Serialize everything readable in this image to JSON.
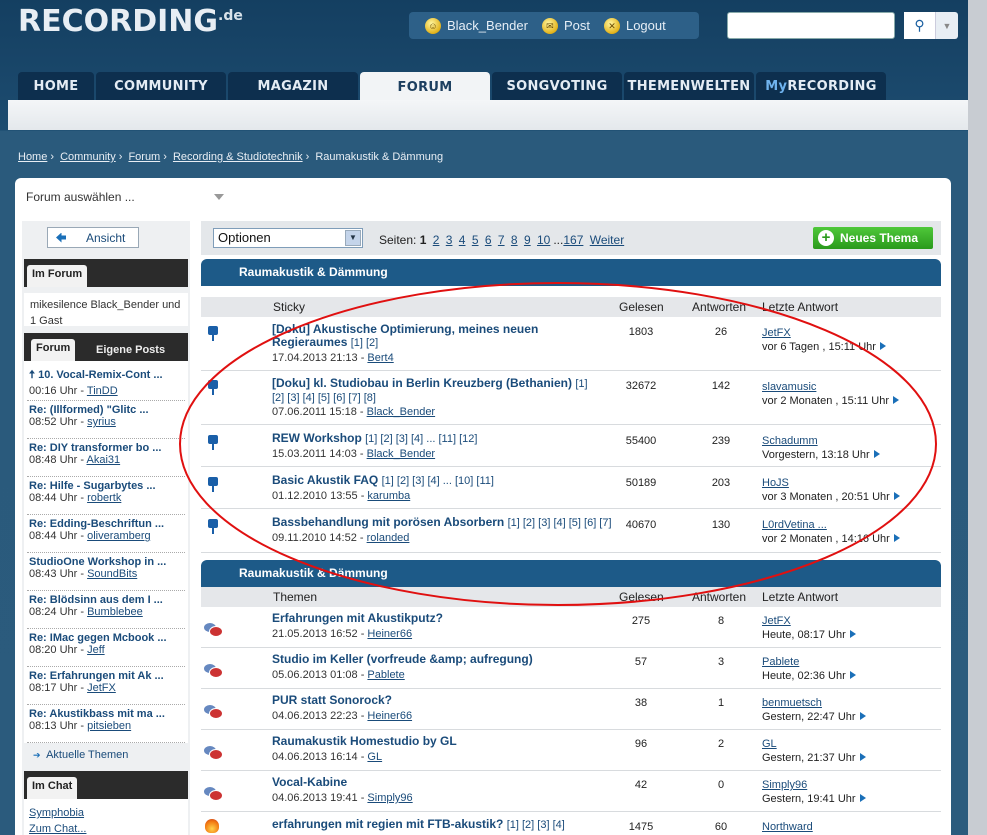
{
  "header": {
    "logo": "RECORDING",
    "logo_suffix": ".de",
    "user": "Black_Bender",
    "post": "Post",
    "logout": "Logout",
    "search_placeholder": ""
  },
  "nav": {
    "tabs": [
      "HOME",
      "COMMUNITY",
      "MAGAZIN",
      "FORUM",
      "SONGVOTING",
      "THEMENWELTEN"
    ],
    "my_prefix": "My",
    "my_suffix": "RECORDING",
    "active": "FORUM"
  },
  "breadcrumb": [
    "Home",
    "Community",
    "Forum",
    "Recording & Studiotechnik",
    "Raumakustik & Dämmung"
  ],
  "forum_select": "Forum auswählen ...",
  "sidebar": {
    "ansicht": "Ansicht",
    "im_forum_tab": "Im Forum",
    "online_text": "mikesilence Black_Bender und 1 Gast",
    "forum_tab": "Forum",
    "eigene_posts_tab": "Eigene Posts",
    "recent": [
      {
        "title": "10. Vocal-Remix-Cont ...",
        "time": "00:16 Uhr - ",
        "user": "TinDD",
        "pinned": true
      },
      {
        "title": "Re: (Illformed) \"Glitc ...",
        "time": "08:52 Uhr - ",
        "user": "syrius"
      },
      {
        "title": "Re: DIY transformer bo ...",
        "time": "08:48 Uhr - ",
        "user": "Akai31"
      },
      {
        "title": "Re: Hilfe - Sugarbytes ...",
        "time": "08:44 Uhr - ",
        "user": "robertk"
      },
      {
        "title": "Re: Edding-Beschriftun ...",
        "time": "08:44 Uhr - ",
        "user": "oliveramberg"
      },
      {
        "title": "StudioOne Workshop in ...",
        "time": "08:43 Uhr - ",
        "user": "SoundBits"
      },
      {
        "title": "Re: Blödsinn aus dem I ...",
        "time": "08:24 Uhr - ",
        "user": "Bumblebee"
      },
      {
        "title": "Re: IMac gegen Mcbook ...",
        "time": "08:20 Uhr - ",
        "user": "Jeff"
      },
      {
        "title": "Re: Erfahrungen mit Ak ...",
        "time": "08:17 Uhr - ",
        "user": "JetFX"
      },
      {
        "title": "Re: Akustikbass mit ma ...",
        "time": "08:13 Uhr - ",
        "user": "pitsieben"
      }
    ],
    "aktuelle_themen": "Aktuelle Themen",
    "im_chat_tab": "Im Chat",
    "chat_users": [
      "Symphobia",
      "Zum Chat..."
    ]
  },
  "toolbar": {
    "optionen": "Optionen",
    "seiten_label": "Seiten:",
    "current_page": "1",
    "pages": [
      "2",
      "3",
      "4",
      "5",
      "6",
      "7",
      "8",
      "9",
      "10"
    ],
    "ellipsis": "...",
    "last_page": "167",
    "weiter": "Weiter",
    "new_thread": "Neues Thema"
  },
  "sticky_section": {
    "title": "Raumakustik & Dämmung",
    "col_topic": "Sticky",
    "col_read": "Gelesen",
    "col_answers": "Antworten",
    "col_last": "Letzte Antwort",
    "rows": [
      {
        "title": "[Doku] Akustische Optimierung, meines neuen Regieraumes",
        "pages": "[1] [2]",
        "date": "17.04.2013 21:13 - ",
        "author": "Bert4",
        "read": "1803",
        "answers": "26",
        "last_user": "JetFX",
        "last_time": "vor 6 Tagen , 15:11 Uhr"
      },
      {
        "title": "[Doku] kl. Studiobau in Berlin Kreuzberg (Bethanien)",
        "pages": "[1] [2] [3] [4] [5] [6] [7] [8]",
        "date": "07.06.2011 15:18 - ",
        "author": "Black_Bender",
        "read": "32672",
        "answers": "142",
        "last_user": "slavamusic",
        "last_time": "vor 2 Monaten , 15:11 Uhr"
      },
      {
        "title": "REW Workshop",
        "pages": "[1] [2] [3] [4] ... [11] [12]",
        "date": "15.03.2011 14:03 - ",
        "author": "Black_Bender",
        "read": "55400",
        "answers": "239",
        "last_user": "Schadumm",
        "last_time": "Vorgestern, 13:18 Uhr"
      },
      {
        "title": "Basic Akustik FAQ",
        "pages": "[1] [2] [3] [4] ... [10] [11]",
        "date": "01.12.2010 13:55 - ",
        "author": "karumba",
        "read": "50189",
        "answers": "203",
        "last_user": "HoJS",
        "last_time": "vor 3 Monaten , 20:51 Uhr"
      },
      {
        "title": "Bassbehandlung mit porösen Absorbern",
        "pages": "[1] [2] [3] [4] [5] [6] [7]",
        "date": "09.11.2010 14:52 - ",
        "author": "rolanded",
        "read": "40670",
        "answers": "130",
        "last_user": "L0rdVetina ...",
        "last_time": "vor 2 Monaten , 14:16 Uhr"
      }
    ]
  },
  "topics_section": {
    "title": "Raumakustik & Dämmung",
    "col_topic": "Themen",
    "col_read": "Gelesen",
    "col_answers": "Antworten",
    "col_last": "Letzte Antwort",
    "rows": [
      {
        "title": "Erfahrungen mit Akustikputz?",
        "pages": "",
        "date": "21.05.2013 16:52 - ",
        "author": "Heiner66",
        "read": "275",
        "answers": "8",
        "last_user": "JetFX",
        "last_time": "Heute, 08:17 Uhr"
      },
      {
        "title": "Studio im Keller (vorfreude &amp; aufregung)",
        "pages": "",
        "date": "05.06.2013 01:08 - ",
        "author": "Pablete",
        "read": "57",
        "answers": "3",
        "last_user": "Pablete",
        "last_time": "Heute, 02:36 Uhr"
      },
      {
        "title": "PUR statt Sonorock?",
        "pages": "",
        "date": "04.06.2013 22:23 - ",
        "author": "Heiner66",
        "read": "38",
        "answers": "1",
        "last_user": "benmuetsch",
        "last_time": "Gestern, 22:47 Uhr"
      },
      {
        "title": "Raumakustik Homestudio by GL",
        "pages": "",
        "date": "04.06.2013 16:14 - ",
        "author": "GL",
        "read": "96",
        "answers": "2",
        "last_user": "GL",
        "last_time": "Gestern, 21:37 Uhr"
      },
      {
        "title": "Vocal-Kabine",
        "pages": "",
        "date": "04.06.2013 19:41 - ",
        "author": "Simply96",
        "read": "42",
        "answers": "0",
        "last_user": "Simply96",
        "last_time": "Gestern, 19:41 Uhr"
      },
      {
        "title": "erfahrungen mit regien mit FTB-akustik?",
        "pages": "[1] [2] [3] [4]",
        "date": "",
        "author": "",
        "read": "1475",
        "answers": "60",
        "last_user": "Northward",
        "last_time": ""
      }
    ]
  },
  "colors": {
    "header": "#143f61",
    "section": "#1d5a88",
    "link": "#1a4b7a",
    "new_thread": "#2a9a1c",
    "annotation": "#e01010"
  }
}
